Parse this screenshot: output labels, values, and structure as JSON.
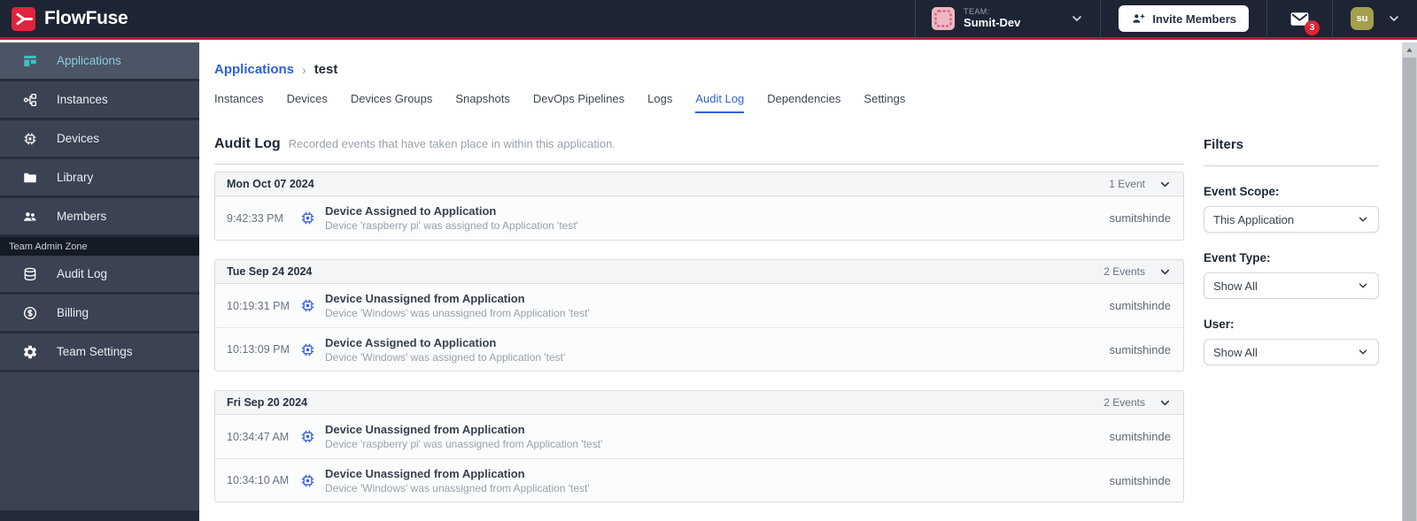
{
  "header": {
    "brand": "FlowFuse",
    "team_label": "TEAM:",
    "team_name": "Sumit-Dev",
    "invite_button": "Invite Members",
    "notification_count": "3",
    "avatar_initials": "su"
  },
  "sidebar": {
    "items": [
      {
        "label": "Applications",
        "icon": "applications-icon",
        "active": true
      },
      {
        "label": "Instances",
        "icon": "instances-icon",
        "active": false
      },
      {
        "label": "Devices",
        "icon": "chip-icon",
        "active": false
      },
      {
        "label": "Library",
        "icon": "folder-icon",
        "active": false
      },
      {
        "label": "Members",
        "icon": "people-icon",
        "active": false
      }
    ],
    "section_label": "Team Admin Zone",
    "admin_items": [
      {
        "label": "Audit Log",
        "icon": "database-icon"
      },
      {
        "label": "Billing",
        "icon": "dollar-circle-icon"
      },
      {
        "label": "Team Settings",
        "icon": "gear-icon"
      }
    ]
  },
  "breadcrumb": {
    "parent": "Applications",
    "separator": "›",
    "current": "test"
  },
  "tabs": {
    "active": "Audit Log",
    "items": [
      {
        "label": "Instances"
      },
      {
        "label": "Devices"
      },
      {
        "label": "Devices Groups"
      },
      {
        "label": "Snapshots"
      },
      {
        "label": "DevOps Pipelines"
      },
      {
        "label": "Logs"
      },
      {
        "label": "Audit Log"
      },
      {
        "label": "Dependencies"
      },
      {
        "label": "Settings"
      }
    ]
  },
  "audit": {
    "title": "Audit Log",
    "subtitle": "Recorded events that have taken place in within this application.",
    "groups": [
      {
        "date": "Mon Oct 07 2024",
        "count_label": "1 Event",
        "events": [
          {
            "time": "9:42:33 PM",
            "icon": "chip-icon",
            "title": "Device Assigned to Application",
            "description": "Device 'raspberry pi' was assigned to Application 'test'",
            "user": "sumitshinde"
          }
        ]
      },
      {
        "date": "Tue Sep 24 2024",
        "count_label": "2 Events",
        "events": [
          {
            "time": "10:19:31 PM",
            "icon": "chip-icon",
            "title": "Device Unassigned from Application",
            "description": "Device 'Windows' was unassigned from Application 'test'",
            "user": "sumitshinde"
          },
          {
            "time": "10:13:09 PM",
            "icon": "chip-icon",
            "title": "Device Assigned to Application",
            "description": "Device 'Windows' was assigned to Application 'test'",
            "user": "sumitshinde"
          }
        ]
      },
      {
        "date": "Fri Sep 20 2024",
        "count_label": "2 Events",
        "events": [
          {
            "time": "10:34:47 AM",
            "icon": "chip-icon",
            "title": "Device Unassigned from Application",
            "description": "Device 'raspberry pi' was unassigned from Application 'test'",
            "user": "sumitshinde"
          },
          {
            "time": "10:34:10 AM",
            "icon": "chip-icon",
            "title": "Device Unassigned from Application",
            "description": "Device 'Windows' was unassigned from Application 'test'",
            "user": "sumitshinde"
          }
        ]
      }
    ]
  },
  "filters": {
    "title": "Filters",
    "fields": [
      {
        "label": "Event Scope:",
        "value": "This Application"
      },
      {
        "label": "Event Type:",
        "value": "Show All"
      },
      {
        "label": "User:",
        "value": "Show All"
      }
    ]
  },
  "colors": {
    "brand_red": "#e0243c",
    "header_bg": "#1d2433",
    "accent_blue": "#2e62d9",
    "sidebar_active_teal": "#3fc0c0",
    "badge_red": "#e02434",
    "event_icon_blue": "#3b63d6"
  }
}
